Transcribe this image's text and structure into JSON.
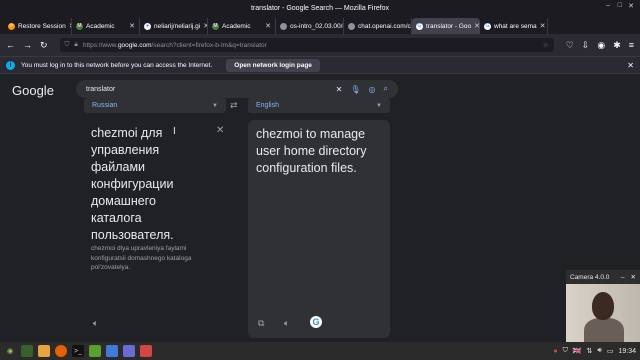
{
  "window": {
    "title": "translator - Google Search — Mozilla Firefox"
  },
  "tabs": [
    {
      "label": "Restore Session",
      "fav_color": "#ff9400",
      "fav_glyph": "⟳"
    },
    {
      "label": "Academic",
      "fav_color": "#4a7a3a",
      "fav_glyph": "M"
    },
    {
      "label": "neliarij/neliarij.gi",
      "fav_color": "#fbfbfe",
      "fav_glyph": "●"
    },
    {
      "label": "Academic",
      "fav_color": "#4a7a3a",
      "fav_glyph": "M"
    },
    {
      "label": "os-intro_02.03.00/r",
      "fav_color": "#8f8f9d",
      "fav_glyph": ""
    },
    {
      "label": "chat.openai.com/c/",
      "fav_color": "#8f8f9d",
      "fav_glyph": ""
    },
    {
      "label": "translator - Goo",
      "fav_color": "#ffffff",
      "fav_glyph": "G",
      "active": true
    },
    {
      "label": "what are sema",
      "fav_color": "#ffffff",
      "fav_glyph": "G"
    }
  ],
  "url": {
    "prefix": "https://www.",
    "domain": "google.com",
    "rest": "/search?client=firefox-b-lm&q=translator"
  },
  "notification": {
    "message": "You must log in to this network before you can access the Internet.",
    "button": "Open network login page"
  },
  "google": {
    "logo": "Google",
    "query": "translator"
  },
  "translator": {
    "source_lang": "Russian",
    "target_lang": "English",
    "source_text": "chezmoi для управления файлами конфигурации домашнего каталога пользователя.",
    "transliteration": "chezmoi dlya upravleniya faylami konfiguratsii domashnego kataloga pol'zovatelya.",
    "target_text": "chezmoi to manage user home directory configuration files."
  },
  "camera": {
    "title": "Camera 4.0.0"
  },
  "taskbar": {
    "clock": "19:34"
  }
}
